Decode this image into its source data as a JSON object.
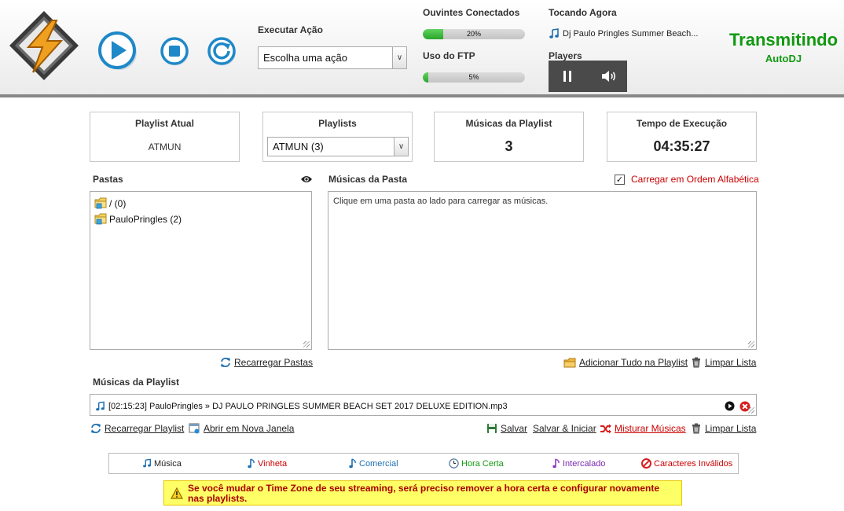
{
  "header": {
    "execute_action_label": "Executar Ação",
    "action_select_value": "Escolha uma ação",
    "listeners_label": "Ouvintes Conectados",
    "listeners_percent": 20,
    "listeners_text": "20%",
    "ftp_label": "Uso do FTP",
    "ftp_percent": 5,
    "ftp_text": "5%",
    "now_playing_label": "Tocando Agora",
    "now_playing_track": "Dj Paulo Pringles Summer Beach...",
    "players_label": "Players",
    "status_title": "Transmitindo",
    "status_mode": "AutoDJ",
    "colors": {
      "accent_blue": "#1e88c8",
      "status_green": "#119911",
      "alert_red": "#cc0000"
    }
  },
  "cards": {
    "current_playlist_title": "Playlist Atual",
    "current_playlist_value": "ATMUN",
    "playlists_title": "Playlists",
    "playlists_select_value": "ATMUN (3)",
    "playlist_songs_title": "Músicas da Playlist",
    "playlist_songs_value": "3",
    "runtime_title": "Tempo de Execução",
    "runtime_value": "04:35:27"
  },
  "folders": {
    "title": "Pastas",
    "items": [
      {
        "label": "/ (0)"
      },
      {
        "label": "PauloPringles (2)"
      }
    ],
    "reload_link": "Recarregar Pastas"
  },
  "folder_songs": {
    "title": "Músicas da Pasta",
    "alpha_order_label": "Carregar em Ordem Alfabética",
    "alpha_order_checked": true,
    "placeholder": "Clique em uma pasta ao lado para carregar as músicas.",
    "add_all_link": "Adicionar Tudo na Playlist",
    "clear_link": "Limpar Lista"
  },
  "playlist": {
    "title": "Músicas da Playlist",
    "items": [
      {
        "label": "[02:15:23] PauloPringles » DJ PAULO PRINGLES SUMMER BEACH SET 2017 DELUXE EDITION.mp3"
      }
    ],
    "reload_link": "Recarregar Playlist",
    "new_window_link": "Abrir em Nova Janela",
    "save_link": "Salvar",
    "save_start_link": "Salvar & Iniciar",
    "shuffle_link": "Misturar Músicas",
    "clear_link": "Limpar Lista"
  },
  "legend": {
    "music": "Música",
    "jingle": "Vinheta",
    "commercial": "Comercial",
    "time": "Hora Certa",
    "interleaved": "Intercalado",
    "invalid": "Caracteres Inválidos"
  },
  "warning": {
    "text": "Se você mudar o Time Zone de seu streaming, será preciso remover a hora certa e configurar novamente nas playlists."
  }
}
